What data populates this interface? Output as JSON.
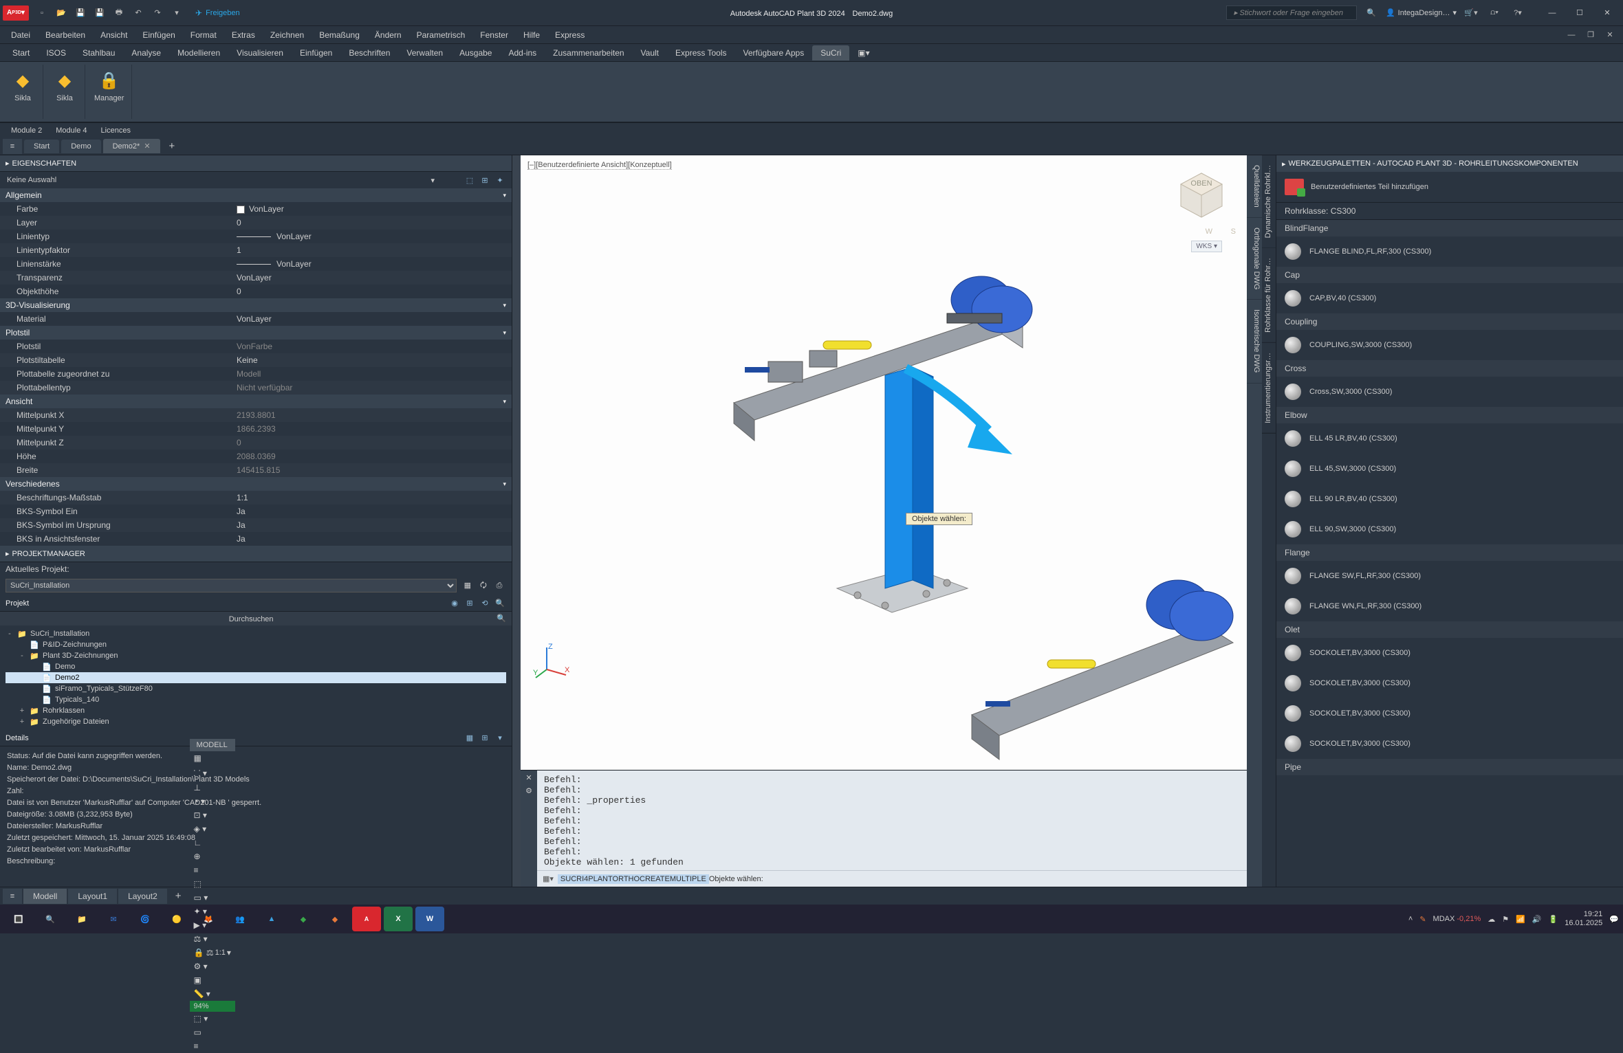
{
  "title_app": "Autodesk AutoCAD Plant 3D 2024",
  "title_doc": "Demo2.dwg",
  "share": "Freigeben",
  "search_placeholder": "Stichwort oder Frage eingeben",
  "user": "IntegaDesign…",
  "menubar": [
    "Datei",
    "Bearbeiten",
    "Ansicht",
    "Einfügen",
    "Format",
    "Extras",
    "Zeichnen",
    "Bemaßung",
    "Ändern",
    "Parametrisch",
    "Fenster",
    "Hilfe",
    "Express"
  ],
  "ribbon_tabs": [
    "Start",
    "ISOS",
    "Stahlbau",
    "Analyse",
    "Modellieren",
    "Visualisieren",
    "Einfügen",
    "Beschriften",
    "Verwalten",
    "Ausgabe",
    "Add-ins",
    "Zusammenarbeiten",
    "Vault",
    "Express Tools",
    "Verfügbare Apps",
    "SuCri"
  ],
  "ribbon_active": "SuCri",
  "ribbon_btns": [
    {
      "label": "Sikla",
      "panel": "Module 2"
    },
    {
      "label": "Sikla",
      "panel": "Module 4"
    },
    {
      "label": "Manager",
      "panel": "Licences"
    }
  ],
  "sub_tabs": [
    "Module 2",
    "Module 4",
    "Licences"
  ],
  "file_tabs": [
    {
      "label": "Start",
      "active": false,
      "closable": false
    },
    {
      "label": "Demo",
      "active": false,
      "closable": false
    },
    {
      "label": "Demo2*",
      "active": true,
      "closable": true
    }
  ],
  "props": {
    "title": "EIGENSCHAFTEN",
    "selection": "Keine Auswahl",
    "sections": [
      {
        "name": "Allgemein",
        "rows": [
          {
            "k": "Farbe",
            "v": "VonLayer",
            "swatch": true
          },
          {
            "k": "Layer",
            "v": "0"
          },
          {
            "k": "Linientyp",
            "v": "VonLayer",
            "line": true
          },
          {
            "k": "Linientypfaktor",
            "v": "1"
          },
          {
            "k": "Linienstärke",
            "v": "VonLayer",
            "line": true
          },
          {
            "k": "Transparenz",
            "v": "VonLayer"
          },
          {
            "k": "Objekthöhe",
            "v": "0"
          }
        ]
      },
      {
        "name": "3D-Visualisierung",
        "rows": [
          {
            "k": "Material",
            "v": "VonLayer"
          }
        ]
      },
      {
        "name": "Plotstil",
        "rows": [
          {
            "k": "Plotstil",
            "v": "VonFarbe",
            "dim": true
          },
          {
            "k": "Plotstiltabelle",
            "v": "Keine"
          },
          {
            "k": "Plottabelle zugeordnet zu",
            "v": "Modell",
            "dim": true
          },
          {
            "k": "Plottabellentyp",
            "v": "Nicht verfügbar",
            "dim": true
          }
        ]
      },
      {
        "name": "Ansicht",
        "rows": [
          {
            "k": "Mittelpunkt X",
            "v": "2193.8801",
            "dim": true
          },
          {
            "k": "Mittelpunkt Y",
            "v": "1866.2393",
            "dim": true
          },
          {
            "k": "Mittelpunkt Z",
            "v": "0",
            "dim": true
          },
          {
            "k": "Höhe",
            "v": "2088.0369",
            "dim": true
          },
          {
            "k": "Breite",
            "v": "145415.815",
            "dim": true
          }
        ]
      },
      {
        "name": "Verschiedenes",
        "rows": [
          {
            "k": "Beschriftungs-Maßstab",
            "v": "1:1"
          },
          {
            "k": "BKS-Symbol Ein",
            "v": "Ja"
          },
          {
            "k": "BKS-Symbol im Ursprung",
            "v": "Ja"
          },
          {
            "k": "BKS in Ansichtsfenster",
            "v": "Ja"
          }
        ]
      }
    ]
  },
  "projmgr": {
    "title": "PROJEKTMANAGER",
    "current_label": "Aktuelles Projekt:",
    "current": "SuCri_Installation",
    "tab": "Projekt",
    "search": "Durchsuchen",
    "tree": [
      {
        "d": 0,
        "exp": "-",
        "icon": "📁",
        "label": "SuCri_Installation"
      },
      {
        "d": 1,
        "exp": "",
        "icon": "📄",
        "label": "P&ID-Zeichnungen"
      },
      {
        "d": 1,
        "exp": "-",
        "icon": "📁",
        "label": "Plant 3D-Zeichnungen"
      },
      {
        "d": 2,
        "exp": "",
        "icon": "📄",
        "label": "Demo"
      },
      {
        "d": 2,
        "exp": "",
        "icon": "📄",
        "label": "Demo2",
        "sel": true
      },
      {
        "d": 2,
        "exp": "",
        "icon": "📄",
        "label": "siFramo_Typicals_StützeF80"
      },
      {
        "d": 2,
        "exp": "",
        "icon": "📄",
        "label": "Typicals_140"
      },
      {
        "d": 1,
        "exp": "+",
        "icon": "📁",
        "label": "Rohrklassen"
      },
      {
        "d": 1,
        "exp": "+",
        "icon": "📁",
        "label": "Zugehörige Dateien"
      }
    ],
    "details_title": "Details",
    "details": [
      "Status: Auf die Datei kann zugegriffen werden.",
      "Name: Demo2.dwg",
      "Speicherort der Datei: D:\\Documents\\SuCri_Installation\\Plant 3D Models",
      "Zahl:",
      "Datei ist von Benutzer 'MarkusRufflar' auf Computer 'CAD201-NB ' gesperrt.",
      "Dateigröße: 3.08MB (3,232,953 Byte)",
      "Dateiersteller: MarkusRufflar",
      "Zuletzt gespeichert: Mittwoch, 15. Januar 2025 16:49:08",
      "Zuletzt bearbeitet von: MarkusRufflar",
      "Beschreibung:"
    ]
  },
  "viewport": {
    "label": "[–][Benutzerdefinierte Ansicht][Konzeptuell]",
    "wcs": "WKS ▾",
    "tooltip": "Objekte wählen:"
  },
  "cmd": {
    "log": "Befehl:\nBefehl:\nBefehl: _properties\nBefehl:\nBefehl:\nBefehl:\nBefehl:\nBefehl:\nObjekte wählen: 1 gefunden",
    "prompt_cmd": "SUCRI4PLANTORTHOCREATEMULTIPLE",
    "prompt_tail": " Objekte wählen:"
  },
  "side_vtabs": [
    "Quelldateien",
    "Orthogonale DWG",
    "Isometrische DWG"
  ],
  "toolpalette": {
    "title": "WERKZEUGPALETTEN - AUTOCAD PLANT 3D - ROHRLEITUNGSKOMPONENTEN",
    "add": "Benutzerdefiniertes Teil hinzufügen",
    "vtabs": [
      "Dynamische Rohrkl…",
      "Rohrklasse für Rohr…",
      "Instrumentierungsr…"
    ],
    "groups": [
      {
        "cat": "Rohrklasse: CS300"
      },
      {
        "sub": "BlindFlange",
        "items": [
          "FLANGE BLIND,FL,RF,300 (CS300)"
        ]
      },
      {
        "sub": "Cap",
        "items": [
          "CAP,BV,40 (CS300)"
        ]
      },
      {
        "sub": "Coupling",
        "items": [
          "COUPLING,SW,3000 (CS300)"
        ]
      },
      {
        "sub": "Cross",
        "items": [
          "Cross,SW,3000 (CS300)"
        ]
      },
      {
        "sub": "Elbow",
        "items": [
          "ELL 45 LR,BV,40 (CS300)",
          "ELL 45,SW,3000 (CS300)",
          "ELL 90 LR,BV,40 (CS300)",
          "ELL 90,SW,3000 (CS300)"
        ]
      },
      {
        "sub": "Flange",
        "items": [
          "FLANGE SW,FL,RF,300 (CS300)",
          "FLANGE WN,FL,RF,300 (CS300)"
        ]
      },
      {
        "sub": "Olet",
        "items": [
          "SOCKOLET,BV,3000 (CS300)",
          "SOCKOLET,BV,3000 (CS300)",
          "SOCKOLET,BV,3000 (CS300)",
          "SOCKOLET,BV,3000 (CS300)"
        ]
      },
      {
        "sub": "Pipe",
        "items": []
      }
    ]
  },
  "layout_tabs": [
    "Modell",
    "Layout1",
    "Layout2"
  ],
  "statusbar": {
    "model": "MODELL",
    "scale": "1:1",
    "pct": "94%"
  },
  "taskbar": {
    "stock": "MDAX",
    "stock_pct": "-0,21%",
    "time": "19:21",
    "date": "16.01.2025"
  }
}
